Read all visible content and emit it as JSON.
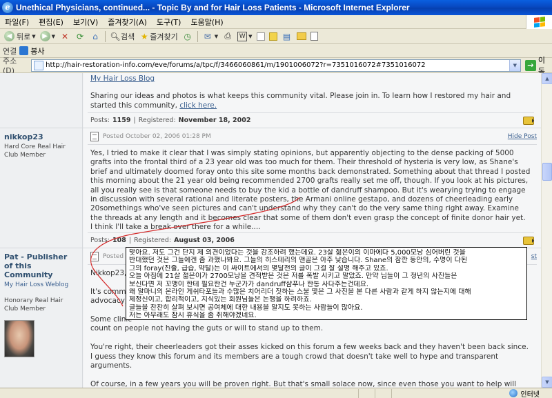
{
  "window": {
    "title": "Unethical Physicians, continued... - Topic By and for Hair Loss Patients - Microsoft Internet Explorer"
  },
  "menu": [
    "파일(F)",
    "편집(E)",
    "보기(V)",
    "즐겨찾기(A)",
    "도구(T)",
    "도움말(H)"
  ],
  "toolbar": {
    "back_label": "뒤로",
    "search_label": "검색",
    "favorites_label": "즐겨찾기"
  },
  "links_bar": {
    "label": "연결",
    "item": "봉사"
  },
  "address_bar": {
    "label": "주소(D)",
    "url": "http://hair-restoration-info.com/eve/forums/a/tpc/f/3466060861/m/1901006072?r=7351016072#7351016072",
    "go_label": "이동"
  },
  "posts": [
    {
      "blog_link": "My Hair Loss Blog",
      "body_lines": [
        "Sharing our ideas and photos is what keeps this community vital. Please join in. To learn how I restored my hair and",
        "started this community, "
      ],
      "body_link": "click here.",
      "posts_label": "Posts:",
      "post_count": "1159",
      "registered_label": "Registered:",
      "registered": "November 18, 2002"
    },
    {
      "username": "nikkop23",
      "user_title": "Hard Core Real Hair Club Member",
      "posted": "Posted October 02, 2006 01:28 PM",
      "hide_label": "Hide Post",
      "body_lines": [
        "Yes, I tried to make it clear that I was simply stating opinions, but apparently objecting to the dense packing of 5000",
        "grafts into the frontal third of a 23 year old was too much for them. Their threshold of hysteria is very low, as Shane's",
        "brief and ultimately doomed foray onto this site some months back demonstrated. Something about that thread I posted",
        "this morning about the 21 year old being recommended 2700 grafts really set me off, though. If you look at his pictures,",
        "all you really see is that someone needs to buy the kid a bottle of dandruff shampoo. But it's wearying trying to engage",
        "in discussion with several rational and literate posters, the Armani online gestapo, and dozens of cheerleading early",
        "20somethings who've seen pictures and can't understand why they can't do the very same thing right away. Examine",
        "the threads at any length and it becomes clear that some of them don't even grasp the concept of finite donor hair yet.",
        "I think I'll take a break over there for a while...."
      ],
      "posts_label": "Posts:",
      "post_count": "108",
      "registered_label": "Registered:",
      "registered": "August 03, 2006"
    },
    {
      "username": "Pat - Publisher of this Community",
      "blog_link": "My Hair Loss Weblog",
      "user_title": "Honorary Real Hair Club Member",
      "posted": "Posted",
      "hide_label": "st",
      "body_lines": [
        "Nikkop23,",
        "",
        "It's comme",
        "advocacy,",
        "",
        "Some clinic",
        "count on people not having the guts or will to stand up to them.",
        "",
        "You're right, their cheerleaders got their asses kicked on this forum a few weeks back and they haven't been back since.",
        "I guess they know this forum and its members are a tough crowd that doesn't take well to hype and transparent",
        "arguments.",
        "",
        "Of course, in a few years you will be proven right. But that's small solace now, since even those you want to help will"
      ]
    }
  ],
  "overlay_lines": [
    "맞아요. 저도 그건 단지 제 의견이었다는 것을 강조하려 했는데요. 23살 젊은이의 이마에다 5,000모낭 심어버린 것을",
    "반대했던 것은 그들에겐 좀 과했나봐요. 그들의 히스테리의 맨골은 아주 낮습니다. Shane의 잠깐 동안의, 수명이 다된",
    "그의 foray(진출, 급습, 약탈)는 이 싸이트에서의 몇달전의 글이 그걸 잘 설명 해주고 있죠.",
    "오늘 아침에 21살 젊은이가 2700모낭을 견적받은 것은 저를 폭발 시키고 말았죠. 만약 님들이 그 청년의 사진들은",
    "보신다면 저 꼬맹이 한테 필요한건 누군가가 dandruff샴푸나 한통 사다주는건데요.",
    " 왜 알마니의 온라인 게쉬타포들과 수많은 치어리더 짓하는 스물 몇은 그 사진을 본  다른 사람과 같게 하지 않는지에 대해",
    "제정신이고, 합리적이고, 지식있는 회원님들은 논쟁을 하려하죠.",
    "글들을 찬찬히 살펴 보시면  공여체에 대한 내용을 알지도 못하는 사람들이 많아요.",
    "저는 아무래도 잠시 휴식을 좀 취해야겠네요."
  ],
  "status_bar": {
    "zone": "인터넷"
  },
  "colors": {
    "title_bar": "#0A55D8",
    "link": "#3a5f8f",
    "username": "#2f4f6f"
  }
}
